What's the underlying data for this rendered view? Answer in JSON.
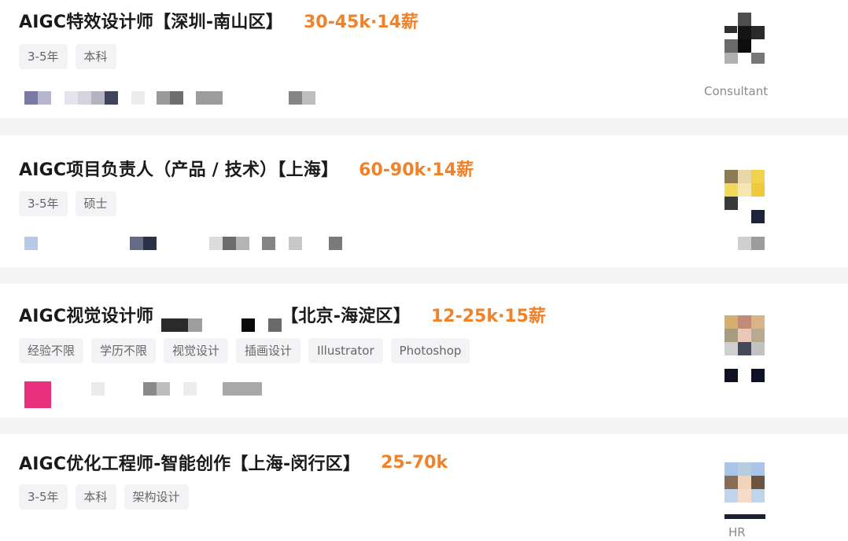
{
  "jobs": [
    {
      "title": "AIGC特效设计师【深圳-南山区】",
      "salary": "30-45k·14薪",
      "tags": [
        "3-5年",
        "本科"
      ],
      "recruiter_label": "Consultant"
    },
    {
      "title": "AIGC项目负责人（产品 / 技术）【上海】",
      "salary": "60-90k·14薪",
      "tags": [
        "3-5年",
        "硕士"
      ],
      "recruiter_label": ""
    },
    {
      "title": "AIGC视觉设计师",
      "title_suffix": "【北京-海淀区】",
      "salary": "12-25k·15薪",
      "tags": [
        "经验不限",
        "学历不限",
        "视觉设计",
        "插画设计",
        "Illustrator",
        "Photoshop"
      ],
      "recruiter_label": ""
    },
    {
      "title": "AIGC优化工程师-智能创作【上海-闵行区】",
      "salary": "25-70k",
      "tags": [
        "3-5年",
        "本科",
        "架构设计"
      ],
      "recruiter_label": "HR"
    }
  ],
  "colors": {
    "salary": "#f0822a",
    "title": "#1a1a1a",
    "tag_bg": "#f3f3f5",
    "tag_text": "#666666"
  }
}
